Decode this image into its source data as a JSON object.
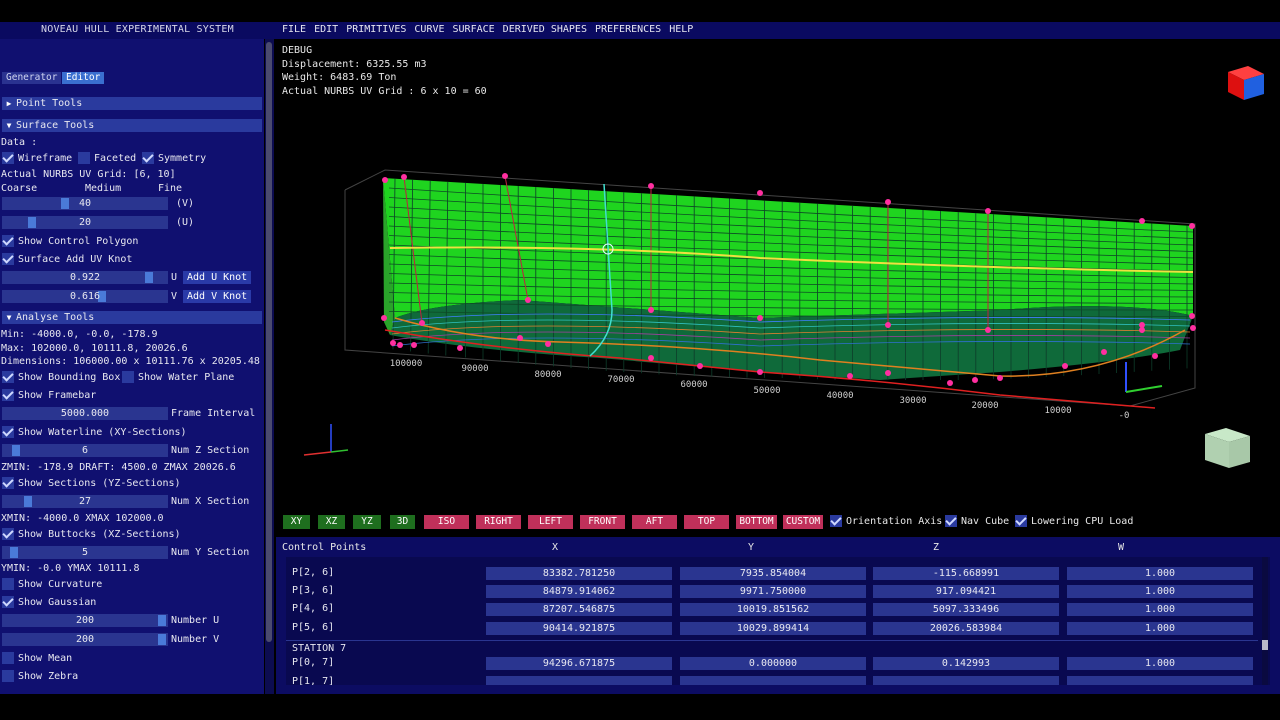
{
  "app": {
    "title": "NOVEAU HULL EXPERIMENTAL SYSTEM"
  },
  "menu": [
    "FILE",
    "EDIT",
    "PRIMITIVES",
    "CURVE",
    "SURFACE",
    "DERIVED SHAPES",
    "PREFERENCES",
    "HELP"
  ],
  "tabs": {
    "generator": "Generator",
    "editor": "Editor"
  },
  "panel": {
    "point_tools": "Point Tools",
    "surface_tools": "Surface Tools",
    "data_label": "Data :",
    "wireframe": "Wireframe",
    "faceted": "Faceted",
    "symmetry": "Symmetry",
    "uv_grid": "Actual NURBS UV Grid: [6, 10]",
    "coarse": "Coarse",
    "medium": "Medium",
    "fine": "Fine",
    "slider_v": "40",
    "slider_v_label": "(V)",
    "slider_u": "20",
    "slider_u_label": "(U)",
    "show_control_polygon": "Show Control Polygon",
    "surface_add_uv_knot": "Surface Add UV Knot",
    "knot_u_value": "0.922",
    "knot_u_axis": "U",
    "add_u_knot": "Add U Knot",
    "knot_v_value": "0.616",
    "knot_v_axis": "V",
    "add_v_knot": "Add V Knot",
    "analyse_tools": "Analyse Tools",
    "min": "Min: -4000.0, -0.0, -178.9",
    "max": "Max: 102000.0, 10111.8, 20026.6",
    "dimensions": "Dimensions: 106000.00 x 10111.76 x 20205.48",
    "show_bounding_box": "Show Bounding Box",
    "show_water_plane": "Show Water Plane",
    "show_framebar": "Show Framebar",
    "frame_interval_value": "5000.000",
    "frame_interval_label": "Frame Interval",
    "show_waterline": "Show Waterline (XY-Sections)",
    "num_z_value": "6",
    "num_z_label": "Num Z Section",
    "zinfo": "ZMIN: -178.9 DRAFT: 4500.0 ZMAX 20026.6",
    "show_sections": "Show Sections (YZ-Sections)",
    "num_x_value": "27",
    "num_x_label": "Num X Section",
    "xinfo": "XMIN: -4000.0 XMAX 102000.0",
    "show_buttocks": "Show Buttocks (XZ-Sections)",
    "num_y_value": "5",
    "num_y_label": "Num Y Section",
    "yinfo": "YMIN: -0.0 YMAX 10111.8",
    "show_curvature": "Show Curvature",
    "show_gaussian": "Show Gaussian",
    "number_u_value": "200",
    "number_u_label": "Number U",
    "number_v_value": "200",
    "number_v_label": "Number V",
    "show_mean": "Show Mean",
    "show_zebra": "Show Zebra"
  },
  "debug": {
    "title": "DEBUG",
    "displacement": "Displacement: 6325.55 m3",
    "weight": "Weight: 6483.69 Ton",
    "grid": "Actual NURBS UV Grid : 6 x 10 = 60"
  },
  "axis_ticks": [
    "100000",
    "90000",
    "80000",
    "70000",
    "60000",
    "50000",
    "40000",
    "30000",
    "20000",
    "10000",
    "-0"
  ],
  "views": [
    "XY",
    "XZ",
    "YZ",
    "3D",
    "ISO",
    "RIGHT",
    "LEFT",
    "FRONT",
    "AFT",
    "TOP",
    "BOTTOM",
    "CUSTOM"
  ],
  "view_options": {
    "orientation_axis": "Orientation Axis",
    "nav_cube": "Nav Cube",
    "lowering_cpu": "Lowering CPU Load"
  },
  "control_points": {
    "title": "Control Points",
    "columns": [
      "X",
      "Y",
      "Z",
      "W"
    ],
    "rows": [
      {
        "label": "P[2, 6]",
        "x": "83382.781250",
        "y": "7935.854004",
        "z": "-115.668991",
        "w": "1.000"
      },
      {
        "label": "P[3, 6]",
        "x": "84879.914062",
        "y": "9971.750000",
        "z": "917.094421",
        "w": "1.000"
      },
      {
        "label": "P[4, 6]",
        "x": "87207.546875",
        "y": "10019.851562",
        "z": "5097.333496",
        "w": "1.000"
      },
      {
        "label": "P[5, 6]",
        "x": "90414.921875",
        "y": "10029.899414",
        "z": "20026.583984",
        "w": "1.000"
      }
    ],
    "station": "STATION 7",
    "row_p07": {
      "label": "P[0, 7]",
      "x": "94296.671875",
      "y": "0.000000",
      "z": "0.142993",
      "w": "1.000"
    },
    "row_p17": {
      "label": "P[1, 7]"
    }
  }
}
